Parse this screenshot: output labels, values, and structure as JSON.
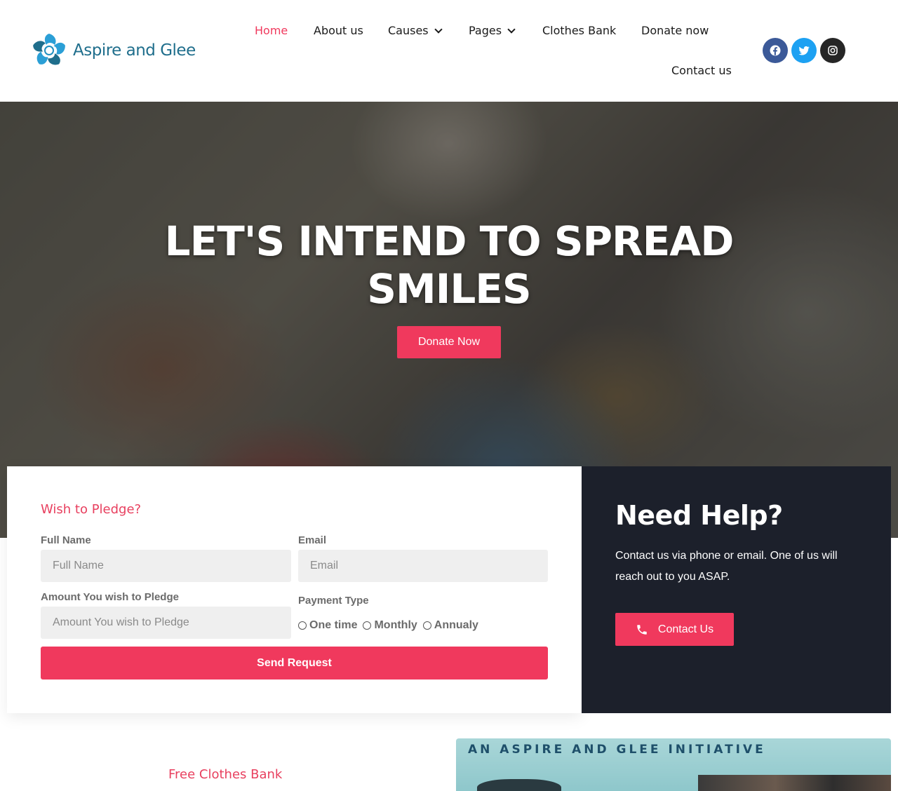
{
  "brand": {
    "name": "Aspire and Glee",
    "accent": "#f0395d",
    "logo_color": "#1f6e8c"
  },
  "nav": {
    "items": [
      {
        "label": "Home",
        "active": true
      },
      {
        "label": "About us"
      },
      {
        "label": "Causes",
        "dropdown": true
      },
      {
        "label": "Pages",
        "dropdown": true
      },
      {
        "label": "Clothes Bank"
      },
      {
        "label": "Donate now"
      },
      {
        "label": "Contact us"
      }
    ]
  },
  "social": [
    {
      "icon": "facebook-icon",
      "color": "#3b5998"
    },
    {
      "icon": "twitter-icon",
      "color": "#1da1f2"
    },
    {
      "icon": "instagram-icon",
      "color": "#262626"
    }
  ],
  "hero": {
    "title": "LET'S INTEND TO SPREAD SMILES",
    "button": "Donate Now"
  },
  "pledge": {
    "title": "Wish to Pledge?",
    "full_name_label": "Full Name",
    "full_name_placeholder": "Full Name",
    "email_label": "Email",
    "email_placeholder": "Email",
    "amount_label": "Amount You wish to Pledge",
    "amount_placeholder": "Amount You wish to Pledge",
    "payment_label": "Payment Type",
    "payment_options": [
      "One time",
      "Monthly",
      "Annualy"
    ],
    "submit": "Send Request"
  },
  "help": {
    "title": "Need Help?",
    "text": "Contact us via phone or email. One of us will reach out to you ASAP.",
    "button": "Contact Us",
    "bg": "#1c202b"
  },
  "section": {
    "label": "Free Clothes Bank",
    "banner_text": "AN ASPIRE AND GLEE INITIATIVE"
  }
}
